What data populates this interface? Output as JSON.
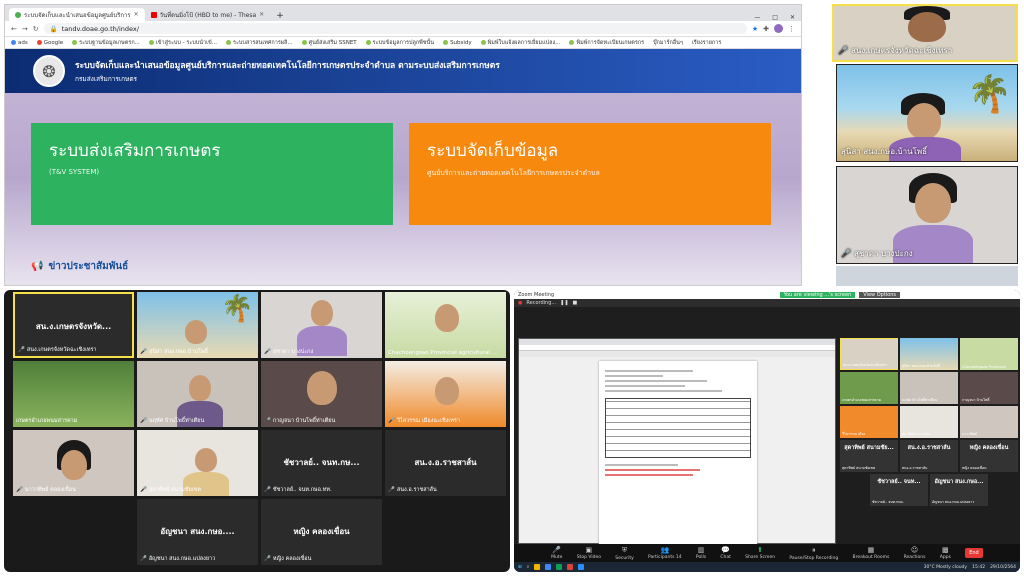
{
  "browser": {
    "tabs": [
      {
        "label": "ระบบจัดเก็บและนำเสนอข้อมูลศูนย์บริการ",
        "active": true
      },
      {
        "label": "วันที่ดนมิ่งโป้ (HBD to me) - Thesa",
        "active": false
      }
    ],
    "new_tab": "+",
    "url": "tandv.doae.go.th/index/",
    "bookmarks": [
      "ads",
      "Google",
      "ระบบฐานข้อมูลเกษตรก...",
      "เข้าสู่ระบบ - ระบบนำเข้...",
      "ระบบสารสนเทศการผลิ...",
      "ศูนย์ส่งเสริม SSNET",
      "ระบบข้อมูลการปลูกพืชนั้น",
      "Subsidy",
      "พิมพ์ใบแจ้งผลการเยี่ยมแปลง...",
      "พิมพ์การจัดทะเบียนเกษตรกร",
      "บุ๊กมาร์กอื่นๆ",
      "เรียงรายการ"
    ],
    "site": {
      "title": "ระบบจัดเก็บและนำเสนอข้อมูลศูนย์บริการและถ่ายทอดเทคโนโลยีการเกษตรประจำตำบล ตามระบบส่งเสริมการเกษตร",
      "subtitle": "กรมส่งเสริมการเกษตร",
      "card_green": {
        "title": "ระบบส่งเสริมการเกษตร",
        "sub": "(T&V SYSTEM)"
      },
      "card_orange": {
        "title": "ระบบจัดเก็บข้อมูล",
        "sub": "ศูนย์บริการและถ่ายทอดเทคโนโลยีการเกษตรประจำตำบล"
      },
      "news": "ข่าวประชาสัมพันธ์"
    }
  },
  "right_tiles": [
    {
      "label": "สนง.เกษตรจังหวัดฉะเชิงเทรา"
    },
    {
      "label": "สุนิสา สนง.กษอ.บ้านโพธิ์"
    },
    {
      "label": "สุชาดา บางปะกง"
    }
  ],
  "gallery": [
    {
      "name": "สน.ง.เกษตรจังหวัด...",
      "small": "สนง.เกษตรจังหวัดฉะเชิงเทรา"
    },
    {
      "name": "",
      "small": "สุนิสา สนง.กษอ.บ้านโพธิ์"
    },
    {
      "name": "",
      "small": "สุชาดา บางปะกง"
    },
    {
      "name": "",
      "small": "Chachoengsao Provincial agricultural ..."
    },
    {
      "name": "",
      "small": "เกษตรอำเภอพนมสารคาม"
    },
    {
      "name": "",
      "small": "นฤพัศ บ้านโพธิ์ท่าเตียน"
    },
    {
      "name": "",
      "small": "กาญจนา บ้านโพธิ์ท่าเตียน"
    },
    {
      "name": "",
      "small": "วิไลวรรณ เมืองฉะเชิงเทรา"
    },
    {
      "name": "",
      "small": "นาวาทิพย์ คลองเขื่อน"
    },
    {
      "name": "",
      "small": "สุดาทิพย์ สนามชัยเขต"
    },
    {
      "name": "ชัชวาลย์.. จนท.กษ...",
      "small": "ชัชวาลย์.. จนท.กษอ.ทท."
    },
    {
      "name": "สน.ง.อ.ราชสาส์น",
      "small": "สนง.อ.ราชสาส์น"
    },
    {
      "name": "อัญชนา สนง.กษอ....",
      "small": "อัญชนา สนง.กษอ.แปลงยาว"
    },
    {
      "name": "หญิง คลองเขื่อน",
      "small": "หญิง คลองเขื่อน"
    }
  ],
  "share": {
    "window_title": "Zoom Meeting",
    "banner": "You are viewing ...'s screen",
    "view_options": "View Options",
    "recording": "Recording...",
    "thumbs": [
      {
        "name": "",
        "small": "สนง.เกษตรจังหวัดฉะเชิงเทรา"
      },
      {
        "name": "",
        "small": "สุนิสา สนง.กษอ.บ้านโพธิ์"
      },
      {
        "name": "",
        "small": "Chachoengsao Provincial"
      },
      {
        "name": "",
        "small": "เกษตรอำเภอพนมสารคาม"
      },
      {
        "name": "",
        "small": "นฤพัศ บ้านโพธิ์ท่าเตียน"
      },
      {
        "name": "",
        "small": "กาญจนา บ้านโพธิ์"
      },
      {
        "name": "",
        "small": "วิไลวรรณ เมือง"
      },
      {
        "name": "",
        "small": "สุดาทิพย์ สนามชัย"
      },
      {
        "name": "",
        "small": "นาวาทิพย์"
      },
      {
        "name": "สุดาทิพย์ สนามชัย...",
        "small": "สุดาทิพย์ สนามชัยเขต"
      },
      {
        "name": "สน.ง.อ.ราชสาส์น",
        "small": "สนง.อ.ราชสาส์น"
      },
      {
        "name": "หญิง คลองเขื่อน",
        "small": "หญิง คลองเขื่อน"
      },
      {
        "name": "ชัชวาลย์.. จนท...",
        "small": "ชัชวาลย์.. จนท.กษอ."
      },
      {
        "name": "อัญชนา สนง.กษอ...",
        "small": "อัญชนา สนง.กษอ.แปลงยาว"
      }
    ],
    "controls": [
      "Mute",
      "Stop Video",
      "Security",
      "Participants",
      "Polls",
      "Chat",
      "Share Screen",
      "Pause/Stop Recording",
      "Breakout Rooms",
      "Reactions",
      "Apps"
    ],
    "participants_count": "14",
    "end": "End",
    "weather": "30°C Mostly cloudy",
    "time": "15:42",
    "date": "29/10/2564"
  },
  "colors": {
    "green": "#2db35f",
    "orange": "#f7890f",
    "header": "#0c2c72",
    "mic_off": "#e53935"
  }
}
